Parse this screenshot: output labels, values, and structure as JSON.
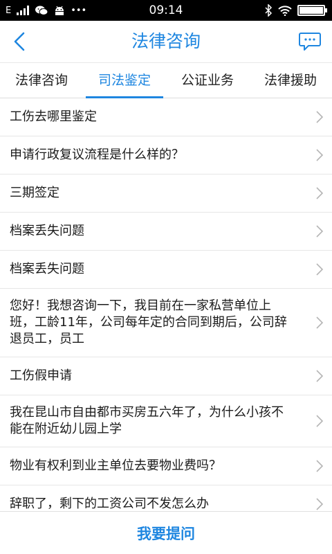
{
  "status_bar": {
    "network": "E",
    "time": "09:14",
    "more": "•••",
    "battery_level": 1.0
  },
  "header": {
    "title": "法律咨询",
    "back_icon": "chevron-left-icon",
    "chat_icon": "chat-bubble-icon"
  },
  "tabs": [
    {
      "label": "法律咨询",
      "active": false
    },
    {
      "label": "司法鉴定",
      "active": true
    },
    {
      "label": "公证业务",
      "active": false
    },
    {
      "label": "法律援助",
      "active": false
    }
  ],
  "questions": [
    "工伤去哪里鉴定",
    "申请行政复议流程是什么样的？",
    "三期签定",
    "档案丢失问题",
    "档案丢失问题",
    "您好！我想咨询一下，我目前在一家私营单位上班，工龄11年，公司每年定的合同到期后，公司辞退员工，员工",
    "工伤假申请",
    "我在昆山市自由都市买房五六年了，为什么小孩不能在附近幼儿园上学",
    "物业有权利到业主单位去要物业费吗？",
    "辞职了，剩下的工资公司不发怎么办"
  ],
  "footer": {
    "ask_label": "我要提问"
  },
  "colors": {
    "accent": "#1e86e0",
    "status_bar_bg": "#000000",
    "divider": "#e6e6e6",
    "chevron": "#b5b5b5"
  }
}
